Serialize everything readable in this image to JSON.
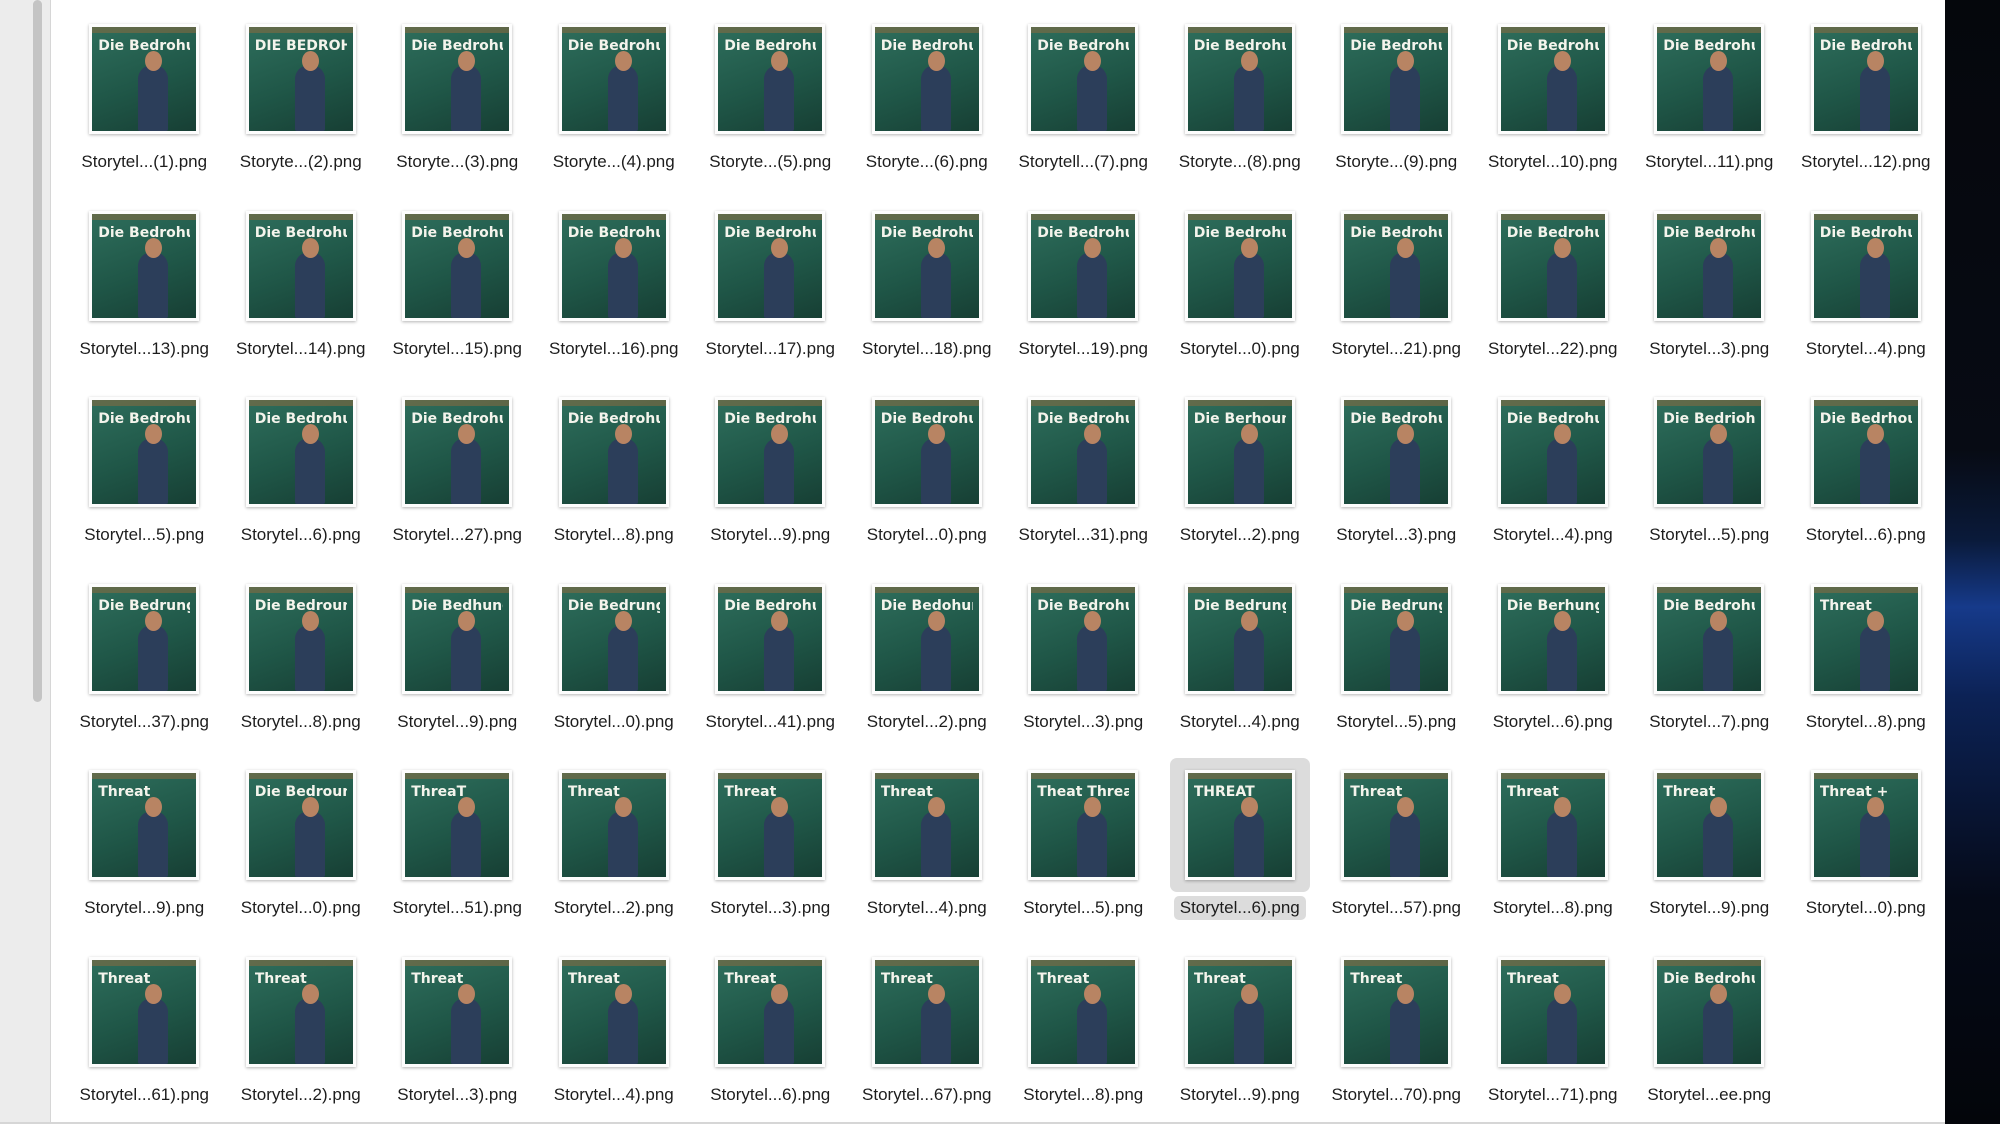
{
  "files": [
    {
      "name": "Storytel...(1).png",
      "chalk": "Die Bedrohung"
    },
    {
      "name": "Storyte...(2).png",
      "chalk": "DIE BEDROHUNG"
    },
    {
      "name": "Storyte...(3).png",
      "chalk": "Die Bedrohung"
    },
    {
      "name": "Storyte...(4).png",
      "chalk": "Die Bedrohung"
    },
    {
      "name": "Storyte...(5).png",
      "chalk": "Die Bedrohung"
    },
    {
      "name": "Storyte...(6).png",
      "chalk": "Die Bedrohung"
    },
    {
      "name": "Storytell...(7).png",
      "chalk": "Die Bedrohung"
    },
    {
      "name": "Storyte...(8).png",
      "chalk": "Die Bedrohung"
    },
    {
      "name": "Storyte...(9).png",
      "chalk": "Die Bedrohung"
    },
    {
      "name": "Storytel...10).png",
      "chalk": "Die Bedrohung"
    },
    {
      "name": "Storytel...11).png",
      "chalk": "Die Bedrohung"
    },
    {
      "name": "Storytel...12).png",
      "chalk": "Die Bedrohung"
    },
    {
      "name": "Storytel...13).png",
      "chalk": "Die Bedrohung"
    },
    {
      "name": "Storytel...14).png",
      "chalk": "Die Bedrohung"
    },
    {
      "name": "Storytel...15).png",
      "chalk": "Die Bedrohung"
    },
    {
      "name": "Storytel...16).png",
      "chalk": "Die Bedrohung"
    },
    {
      "name": "Storytel...17).png",
      "chalk": "Die Bedrohung"
    },
    {
      "name": "Storytel...18).png",
      "chalk": "Die Bedrohung"
    },
    {
      "name": "Storytel...19).png",
      "chalk": "Die Bedrohung"
    },
    {
      "name": "Storytel...0).png",
      "chalk": "Die Bedrohung"
    },
    {
      "name": "Storytel...21).png",
      "chalk": "Die Bedrohung"
    },
    {
      "name": "Storytel...22).png",
      "chalk": "Die Bedrohung"
    },
    {
      "name": "Storytel...3).png",
      "chalk": "Die Bedrohung"
    },
    {
      "name": "Storytel...4).png",
      "chalk": "Die Bedrohung"
    },
    {
      "name": "Storytel...5).png",
      "chalk": "Die Bedrohung"
    },
    {
      "name": "Storytel...6).png",
      "chalk": "Die Bedrohung"
    },
    {
      "name": "Storytel...27).png",
      "chalk": "Die Bedrohung"
    },
    {
      "name": "Storytel...8).png",
      "chalk": "Die Bedrohung"
    },
    {
      "name": "Storytel...9).png",
      "chalk": "Die Bedrohung"
    },
    {
      "name": "Storytel...0).png",
      "chalk": "Die Bedrohung"
    },
    {
      "name": "Storytel...31).png",
      "chalk": "Die Bedrohung"
    },
    {
      "name": "Storytel...2).png",
      "chalk": "Die Berhoung"
    },
    {
      "name": "Storytel...3).png",
      "chalk": "Die Bedrohung"
    },
    {
      "name": "Storytel...4).png",
      "chalk": "Die Bedrohung"
    },
    {
      "name": "Storytel...5).png",
      "chalk": "Die Bedriohung"
    },
    {
      "name": "Storytel...6).png",
      "chalk": "Die Bedrhoung"
    },
    {
      "name": "Storytel...37).png",
      "chalk": "Die Bedrung"
    },
    {
      "name": "Storytel...8).png",
      "chalk": "Die Bedroung."
    },
    {
      "name": "Storytel...9).png",
      "chalk": "Die Bedhung"
    },
    {
      "name": "Storytel...0).png",
      "chalk": "Die Bedrung"
    },
    {
      "name": "Storytel...41).png",
      "chalk": "Die Bedrohung"
    },
    {
      "name": "Storytel...2).png",
      "chalk": "Die Bedohung"
    },
    {
      "name": "Storytel...3).png",
      "chalk": "Die Bedrohung"
    },
    {
      "name": "Storytel...4).png",
      "chalk": "Die Bedrung"
    },
    {
      "name": "Storytel...5).png",
      "chalk": "Die Bedrung"
    },
    {
      "name": "Storytel...6).png",
      "chalk": "Die Berhung"
    },
    {
      "name": "Storytel...7).png",
      "chalk": "Die Bedrohung"
    },
    {
      "name": "Storytel...8).png",
      "chalk": "Threat"
    },
    {
      "name": "Storytel...9).png",
      "chalk": "Threat"
    },
    {
      "name": "Storytel...0).png",
      "chalk": "Die Bedroun"
    },
    {
      "name": "Storytel...51).png",
      "chalk": "ThreaT"
    },
    {
      "name": "Storytel...2).png",
      "chalk": "Threat"
    },
    {
      "name": "Storytel...3).png",
      "chalk": "Threat"
    },
    {
      "name": "Storytel...4).png",
      "chalk": "Threat"
    },
    {
      "name": "Storytel...5).png",
      "chalk": "Theat Threat"
    },
    {
      "name": "Storytel...6).png",
      "chalk": "THREAT",
      "selected": true
    },
    {
      "name": "Storytel...57).png",
      "chalk": "Threat"
    },
    {
      "name": "Storytel...8).png",
      "chalk": "Threat"
    },
    {
      "name": "Storytel...9).png",
      "chalk": "Threat"
    },
    {
      "name": "Storytel...0).png",
      "chalk": "Threat +"
    },
    {
      "name": "Storytel...61).png",
      "chalk": "Threat"
    },
    {
      "name": "Storytel...2).png",
      "chalk": "Threat"
    },
    {
      "name": "Storytel...3).png",
      "chalk": "Threat"
    },
    {
      "name": "Storytel...4).png",
      "chalk": "Threat"
    },
    {
      "name": "Storytel...6).png",
      "chalk": "Threat"
    },
    {
      "name": "Storytel...67).png",
      "chalk": "Threat"
    },
    {
      "name": "Storytel...8).png",
      "chalk": "Threat"
    },
    {
      "name": "Storytel...9).png",
      "chalk": "Threat"
    },
    {
      "name": "Storytel...70).png",
      "chalk": "Threat"
    },
    {
      "name": "Storytel...71).png",
      "chalk": "Threat"
    },
    {
      "name": "Storytel...ee.png",
      "chalk": "Die Bedrohung"
    }
  ]
}
